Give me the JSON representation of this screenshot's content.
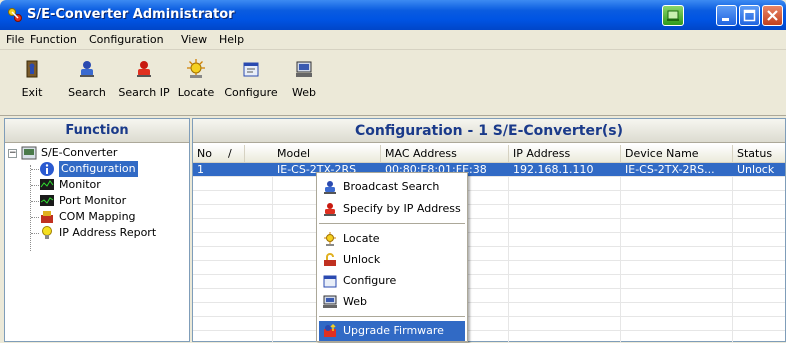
{
  "window": {
    "title": "S/E-Converter Administrator"
  },
  "menu": {
    "items": [
      "File",
      "Function",
      "Configuration",
      "View",
      "Help"
    ]
  },
  "toolbar": {
    "items": [
      {
        "label": "Exit",
        "icon": "exit-icon"
      },
      {
        "label": "Search",
        "icon": "search-icon"
      },
      {
        "label": "Search IP",
        "icon": "search-ip-icon"
      },
      {
        "label": "Locate",
        "icon": "locate-icon"
      },
      {
        "label": "Configure",
        "icon": "configure-icon"
      },
      {
        "label": "Web",
        "icon": "web-icon"
      }
    ]
  },
  "left_panel": {
    "title": "Function",
    "tree": {
      "root": "S/E-Converter",
      "children": [
        "Configuration",
        "Monitor",
        "Port Monitor",
        "COM Mapping",
        "IP Address Report"
      ]
    }
  },
  "right_panel": {
    "title": "Configuration - 1 S/E-Converter(s)",
    "columns": [
      "No",
      "/",
      "Model",
      "MAC Address",
      "IP Address",
      "Device Name",
      "Status"
    ],
    "rows": [
      {
        "no": "1",
        "model": "IE-CS-2TX-2RS",
        "mac": "00:80:E8:01:FE:38",
        "ip": "192.168.1.110",
        "device_name": "IE-CS-2TX-2RS...",
        "status": "Unlock"
      }
    ]
  },
  "context_menu": {
    "items": [
      {
        "label": "Broadcast Search",
        "icon": "broadcast-search-icon"
      },
      {
        "label": "Specify by IP Address",
        "icon": "specify-ip-icon"
      },
      {
        "label": "Locate",
        "icon": "locate-icon"
      },
      {
        "label": "Unlock",
        "icon": "unlock-icon"
      },
      {
        "label": "Configure",
        "icon": "configure-icon"
      },
      {
        "label": "Web",
        "icon": "web-icon"
      },
      {
        "label": "Upgrade Firmware",
        "icon": "upgrade-firmware-icon"
      }
    ],
    "highlighted": "Upgrade Firmware"
  },
  "colors": {
    "titlebar": "#0054e3",
    "selection": "#316ac5",
    "panel_title": "#1a3a8a"
  }
}
